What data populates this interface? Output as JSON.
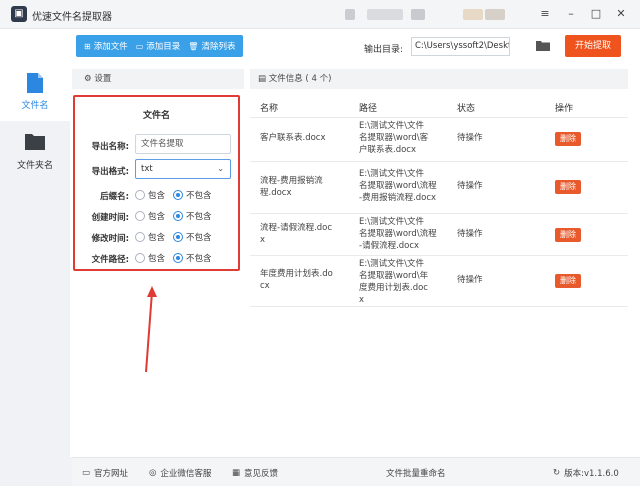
{
  "app": {
    "title": "优速文件名提取器"
  },
  "window": {
    "menu_icon": "hamburger-icon",
    "min_icon": "minimize-icon",
    "max_icon": "maximize-icon",
    "close_icon": "close-icon"
  },
  "toolbar": {
    "add_file": "添加文件",
    "add_folder": "添加目录",
    "clear_list": "清除列表",
    "output_label": "输出目录:",
    "output_path": "C:\\Users\\yssoft2\\Deskt",
    "start_button": "开始提取"
  },
  "sidebar": {
    "items": [
      {
        "label": "文件名",
        "icon": "file-icon",
        "active": true
      },
      {
        "label": "文件夹名",
        "icon": "folder-icon",
        "active": false
      }
    ]
  },
  "settings": {
    "header": "设置",
    "box_title": "文件名",
    "export_name_label": "导出名称:",
    "export_name_value": "文件名提取",
    "export_format_label": "导出格式:",
    "export_format_value": "txt",
    "rows": [
      {
        "label": "后缀名:",
        "include": "包含",
        "exclude": "不包含",
        "selected": "exclude"
      },
      {
        "label": "创建时间:",
        "include": "包含",
        "exclude": "不包含",
        "selected": "exclude"
      },
      {
        "label": "修改时间:",
        "include": "包含",
        "exclude": "不包含",
        "selected": "exclude"
      },
      {
        "label": "文件路径:",
        "include": "包含",
        "exclude": "不包含",
        "selected": "exclude"
      }
    ]
  },
  "files": {
    "header": "文件信息 ( 4 个)",
    "columns": {
      "name": "名称",
      "path": "路径",
      "status": "状态",
      "action": "操作"
    },
    "rows": [
      {
        "name": [
          "客户联系表.docx"
        ],
        "path": [
          "E:\\测试文件\\文件",
          "名提取器\\word\\客",
          "户联系表.docx"
        ],
        "status": "待操作",
        "action": "删除"
      },
      {
        "name": [
          "流程-费用报销流",
          "程.docx"
        ],
        "path": [
          "E:\\测试文件\\文件",
          "名提取器\\word\\流程",
          "-费用报销流程.docx"
        ],
        "status": "待操作",
        "action": "删除"
      },
      {
        "name": [
          "流程-请假流程.doc",
          "x"
        ],
        "path": [
          "E:\\测试文件\\文件",
          "名提取器\\word\\流程",
          "-请假流程.docx"
        ],
        "status": "待操作",
        "action": "删除"
      },
      {
        "name": [
          "年度费用计划表.do",
          "cx"
        ],
        "path": [
          "E:\\测试文件\\文件",
          "名提取器\\word\\年",
          "度费用计划表.doc",
          "x"
        ],
        "status": "待操作",
        "action": "删除"
      }
    ]
  },
  "footer": {
    "website": "官方网址",
    "wechat": "企业微信客服",
    "feedback": "意见反馈",
    "center": "文件批量重命名",
    "version": "版本:v1.1.6.0"
  },
  "colors": {
    "accent": "#3aa0e8",
    "start": "#f0541e",
    "delete": "#e85a2c",
    "highlight_box": "#e03b34"
  }
}
